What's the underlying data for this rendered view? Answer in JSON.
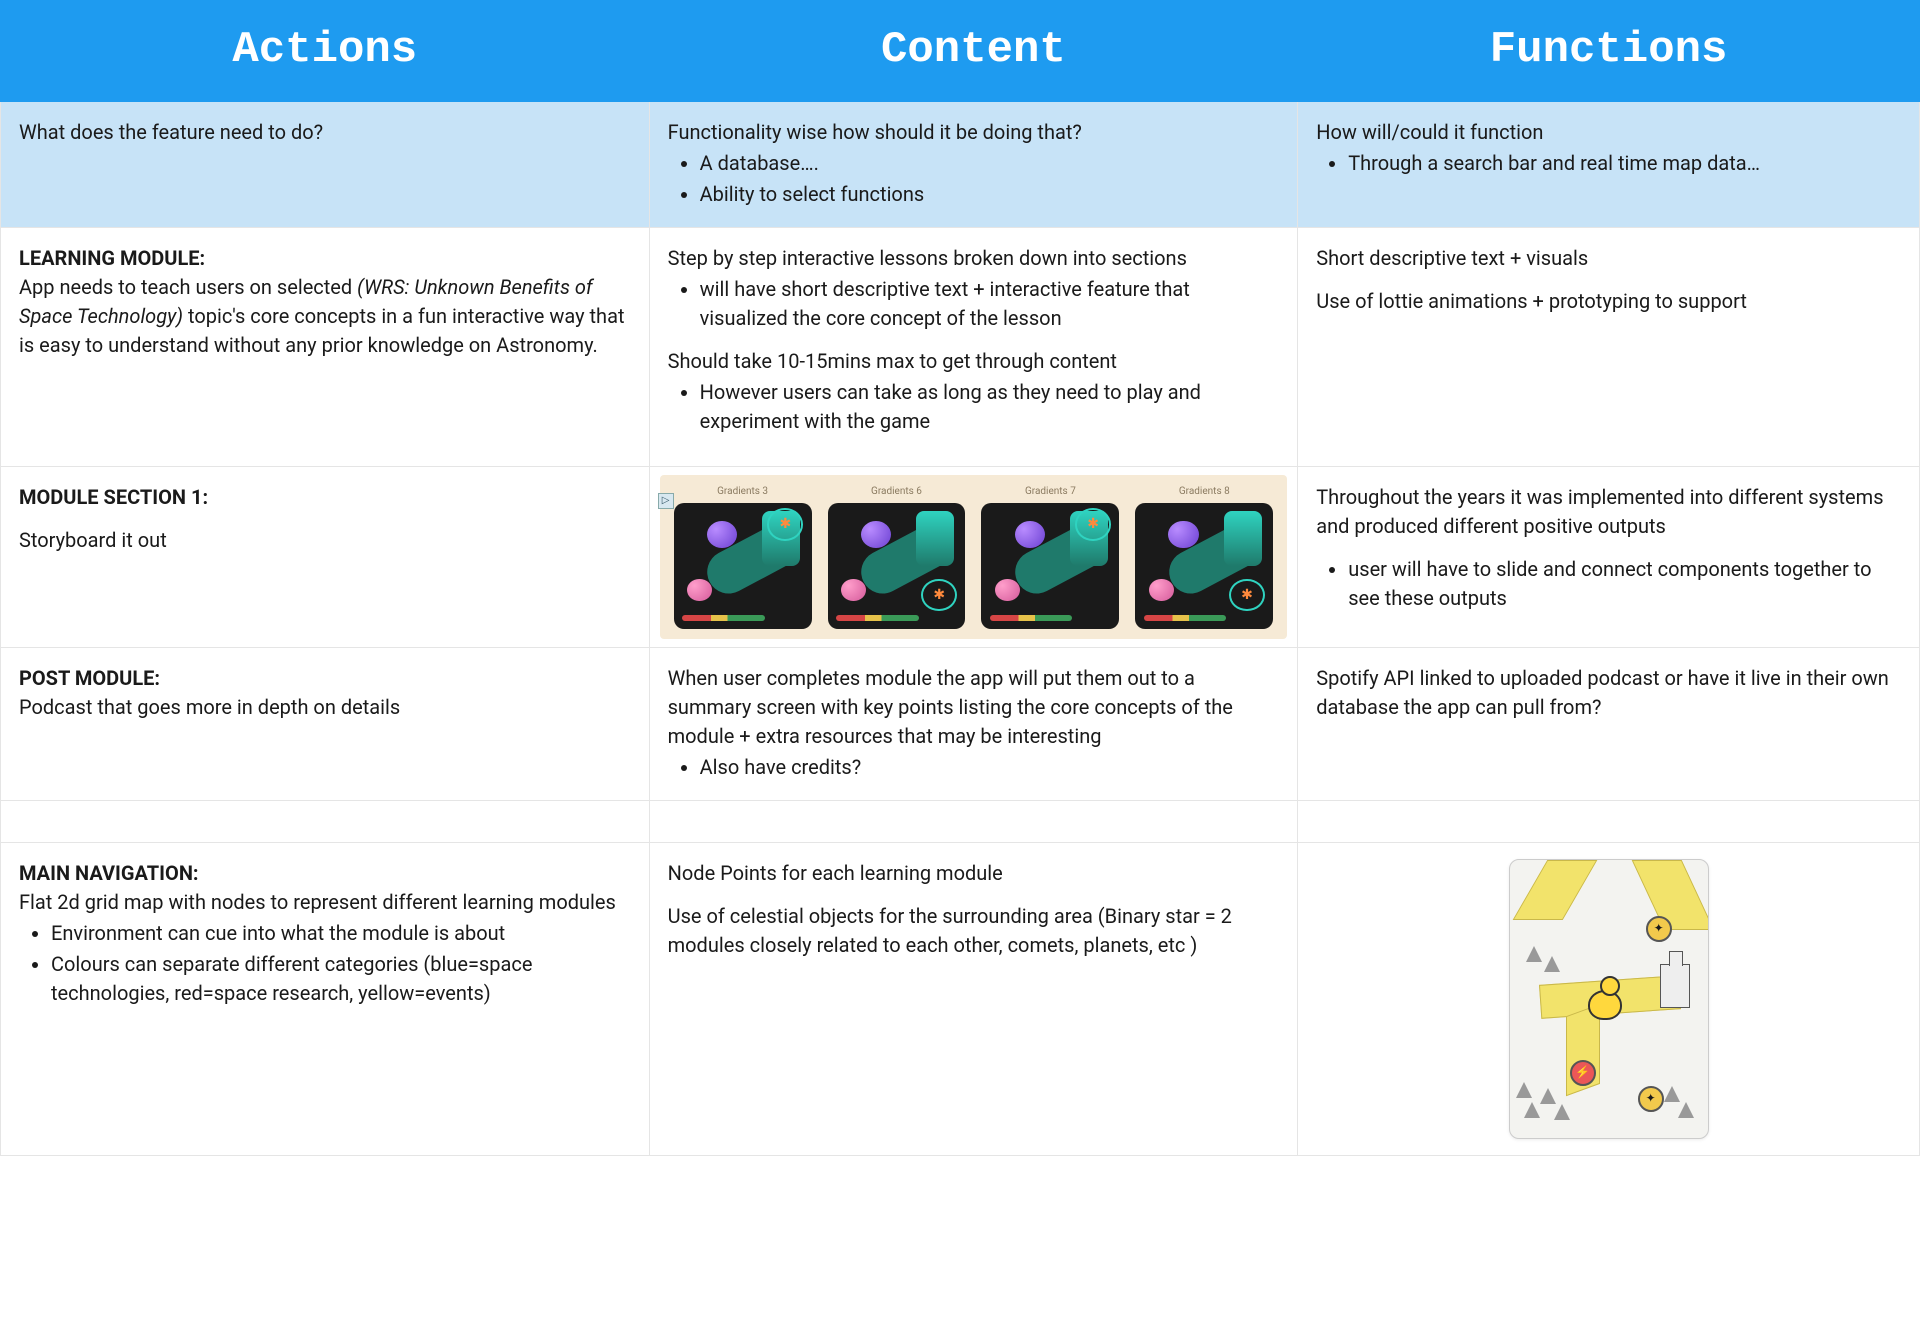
{
  "header": {
    "col1": "Actions",
    "col2": "Content",
    "col3": "Functions"
  },
  "sub": {
    "actions": "What does the feature need to do?",
    "content_intro": "Functionality wise how should it be doing that?",
    "content_b1": "A database….",
    "content_b2": "Ability to select functions",
    "functions_intro": "How will/could it function",
    "functions_b1": "Through a search bar and real time map data…"
  },
  "r1": {
    "a_title": "LEARNING MODULE:",
    "a_pre": "App needs to teach users on selected ",
    "a_italic": "(WRS: Unknown Benefits of Space Technology)",
    "a_post": " topic's core concepts in a fun interactive way that is easy to understand without any prior knowledge on Astronomy.",
    "c_p1": "Step by step interactive lessons broken down into sections",
    "c_b1": "will have short descriptive text + interactive feature that visualized the core concept of the lesson",
    "c_p2": "Should take 10-15mins max to get through content",
    "c_b2": "However users can take as long as they need to play and experiment with the game",
    "f_p1": "Short descriptive text + visuals",
    "f_p2": "Use of lottie animations + prototyping to support"
  },
  "r2": {
    "a_title": "MODULE SECTION 1:",
    "a_p": "Storyboard it out",
    "grad1": "Gradients 3",
    "grad2": "Gradients 6",
    "grad3": "Gradients 7",
    "grad4": "Gradients 8",
    "f_p1": "Throughout the years it was implemented into different systems and produced different positive outputs",
    "f_b1": "user will have to slide and connect components together to see these outputs"
  },
  "r3": {
    "a_title": "POST MODULE:",
    "a_p": "Podcast that goes more in depth on details",
    "c_p": "When user completes module the app will put them out to a summary screen with key points listing the core concepts of the module + extra resources that may be interesting",
    "c_b1": "Also have credits?",
    "f_p": "Spotify API linked to uploaded podcast or have it live in their own database the app can pull from?"
  },
  "r4": {
    "a_title": "MAIN NAVIGATION:",
    "a_p": "Flat 2d grid map with nodes to represent different learning modules",
    "a_b1": "Environment can cue into what the module is about",
    "a_b2": "Colours can separate different categories (blue=space technologies, red=space research, yellow=events)",
    "c_p1": "Node Points for each learning module",
    "c_p2": "Use of celestial objects for the surrounding area (Binary star = 2 modules closely related to each other, comets, planets, etc )"
  }
}
